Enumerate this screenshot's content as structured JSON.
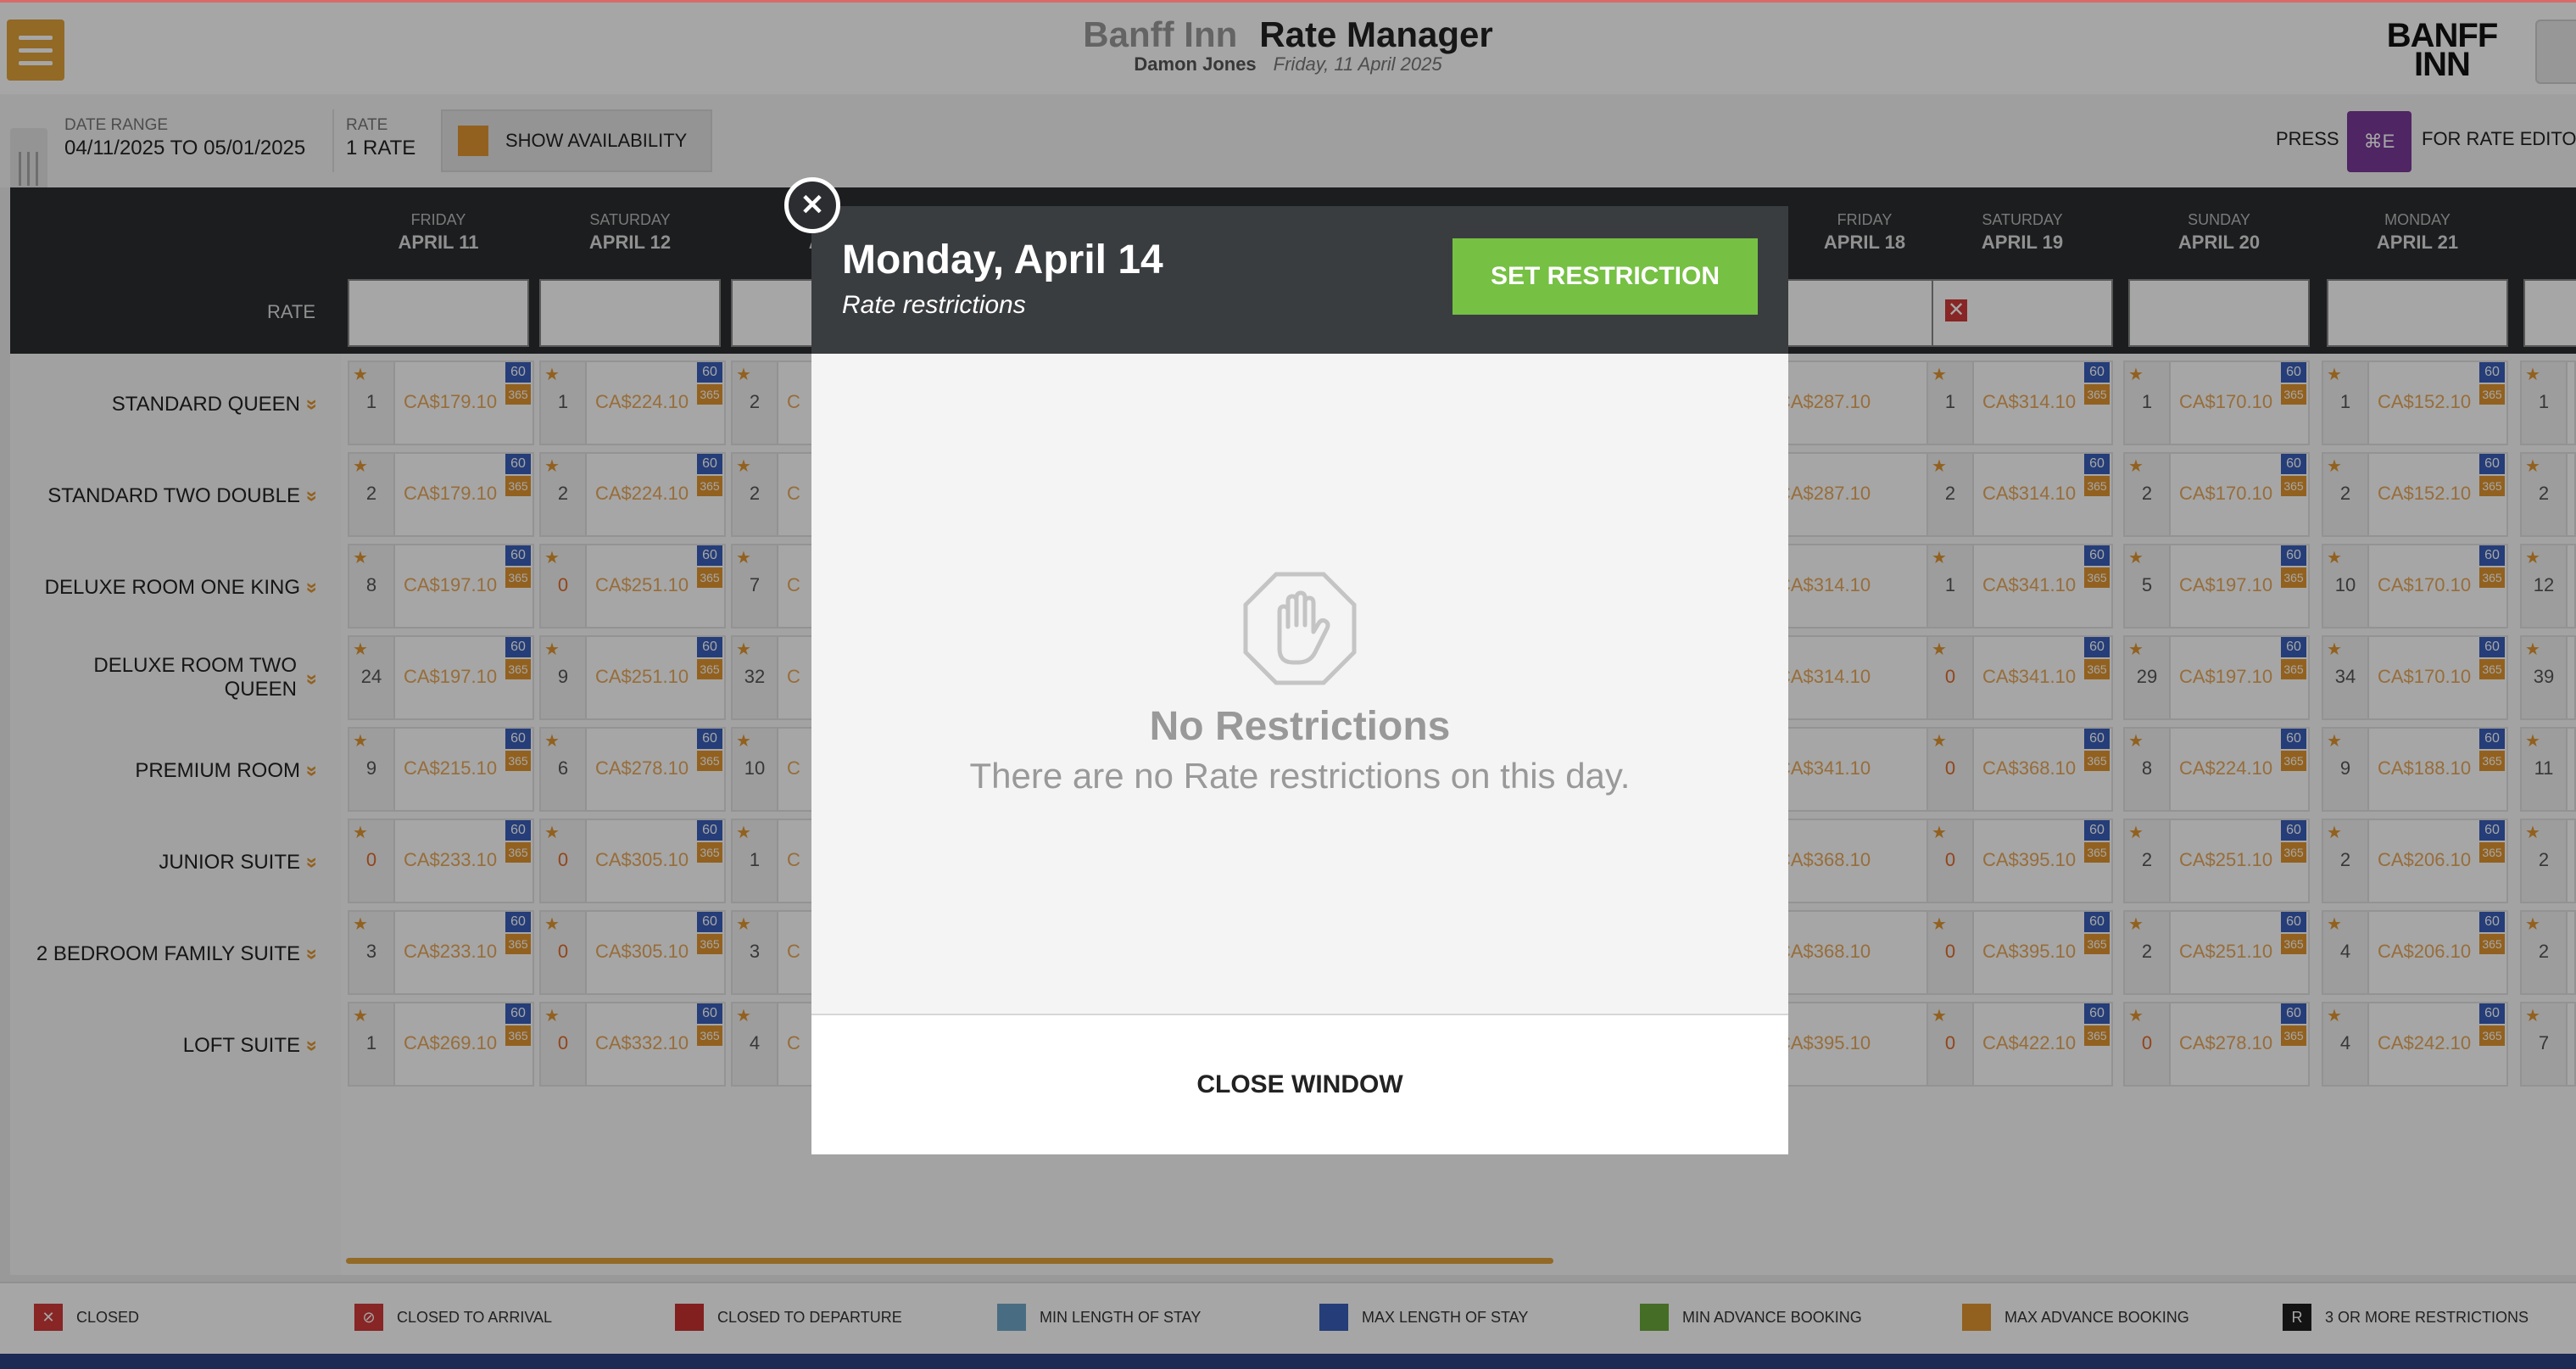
{
  "header": {
    "hotel": "Banff Inn",
    "app_title": "Rate Manager",
    "user": "Damon Jones",
    "date": "Friday, 11 April 2025",
    "logo_line1": "BANFF",
    "logo_line2": "INN"
  },
  "toolbar": {
    "date_range_label": "DATE RANGE",
    "date_range_value": "04/11/2025 TO 05/01/2025",
    "rate_label": "RATE",
    "rate_value": "1 RATE",
    "availability_button": "SHOW AVAILABILITY",
    "press": "PRESS",
    "shortcut": "⌘E",
    "for_rate_editor": "FOR RATE EDITOR"
  },
  "grid": {
    "rate_row_label": "RATE",
    "columns": [
      {
        "dow": "FRIDAY",
        "date": "APRIL 11"
      },
      {
        "dow": "SATURDAY",
        "date": "APRIL 12"
      },
      {
        "dow": "",
        "date": "AP"
      },
      {
        "dow": "FRIDAY",
        "date": "APRIL 18"
      },
      {
        "dow": "SATURDAY",
        "date": "APRIL 19"
      },
      {
        "dow": "SUNDAY",
        "date": "APRIL 20"
      },
      {
        "dow": "MONDAY",
        "date": "APRIL 21"
      }
    ],
    "closed_mark": "✕",
    "rooms": [
      {
        "name": "STANDARD QUEEN",
        "cells": [
          [
            "1",
            "CA$179.10"
          ],
          [
            "1",
            "CA$224.10"
          ],
          [
            "2",
            "C"
          ],
          [
            "",
            "CA$287.10"
          ],
          [
            "1",
            "CA$314.10"
          ],
          [
            "1",
            "CA$170.10"
          ],
          [
            "1",
            "CA$152.10"
          ],
          [
            "1",
            ""
          ]
        ]
      },
      {
        "name": "STANDARD TWO DOUBLE",
        "cells": [
          [
            "2",
            "CA$179.10"
          ],
          [
            "2",
            "CA$224.10"
          ],
          [
            "2",
            "C"
          ],
          [
            "",
            "CA$287.10"
          ],
          [
            "2",
            "CA$314.10"
          ],
          [
            "2",
            "CA$170.10"
          ],
          [
            "2",
            "CA$152.10"
          ],
          [
            "2",
            ""
          ]
        ]
      },
      {
        "name": "DELUXE ROOM ONE KING",
        "cells": [
          [
            "8",
            "CA$197.10"
          ],
          [
            "0",
            "CA$251.10"
          ],
          [
            "7",
            "C"
          ],
          [
            "",
            "CA$314.10"
          ],
          [
            "1",
            "CA$341.10"
          ],
          [
            "5",
            "CA$197.10"
          ],
          [
            "10",
            "CA$170.10"
          ],
          [
            "12",
            ""
          ]
        ]
      },
      {
        "name": "DELUXE ROOM TWO QUEEN",
        "cells": [
          [
            "24",
            "CA$197.10"
          ],
          [
            "9",
            "CA$251.10"
          ],
          [
            "32",
            "C"
          ],
          [
            "",
            "CA$314.10"
          ],
          [
            "0",
            "CA$341.10"
          ],
          [
            "29",
            "CA$197.10"
          ],
          [
            "34",
            "CA$170.10"
          ],
          [
            "39",
            ""
          ]
        ]
      },
      {
        "name": "PREMIUM ROOM",
        "cells": [
          [
            "9",
            "CA$215.10"
          ],
          [
            "6",
            "CA$278.10"
          ],
          [
            "10",
            "C"
          ],
          [
            "",
            "CA$341.10"
          ],
          [
            "0",
            "CA$368.10"
          ],
          [
            "8",
            "CA$224.10"
          ],
          [
            "9",
            "CA$188.10"
          ],
          [
            "11",
            ""
          ]
        ]
      },
      {
        "name": "JUNIOR SUITE",
        "cells": [
          [
            "0",
            "CA$233.10"
          ],
          [
            "0",
            "CA$305.10"
          ],
          [
            "1",
            "C"
          ],
          [
            "",
            "CA$368.10"
          ],
          [
            "0",
            "CA$395.10"
          ],
          [
            "2",
            "CA$251.10"
          ],
          [
            "2",
            "CA$206.10"
          ],
          [
            "2",
            ""
          ]
        ]
      },
      {
        "name": "2 BEDROOM FAMILY SUITE",
        "cells": [
          [
            "3",
            "CA$233.10"
          ],
          [
            "0",
            "CA$305.10"
          ],
          [
            "3",
            "C"
          ],
          [
            "",
            "CA$368.10"
          ],
          [
            "0",
            "CA$395.10"
          ],
          [
            "2",
            "CA$251.10"
          ],
          [
            "4",
            "CA$206.10"
          ],
          [
            "2",
            ""
          ]
        ]
      },
      {
        "name": "LOFT SUITE",
        "cells": [
          [
            "1",
            "CA$269.10"
          ],
          [
            "0",
            "CA$332.10"
          ],
          [
            "4",
            "C"
          ],
          [
            "",
            "CA$395.10"
          ],
          [
            "0",
            "CA$422.10"
          ],
          [
            "0",
            "CA$278.10"
          ],
          [
            "4",
            "CA$242.10"
          ],
          [
            "7",
            ""
          ]
        ]
      }
    ],
    "badge_top": "60",
    "badge_bottom": "365"
  },
  "legend": [
    {
      "label": "CLOSED",
      "color": "#d23a3a",
      "glyph": "✕"
    },
    {
      "label": "CLOSED TO ARRIVAL",
      "color": "#d23a3a",
      "glyph": "⊘"
    },
    {
      "label": "CLOSED TO DEPARTURE",
      "color": "#c83232",
      "glyph": ""
    },
    {
      "label": "MIN LENGTH OF STAY",
      "color": "#6fa8c8",
      "glyph": ""
    },
    {
      "label": "MAX LENGTH OF STAY",
      "color": "#3a5fb8",
      "glyph": ""
    },
    {
      "label": "MIN ADVANCE BOOKING",
      "color": "#6ba83a",
      "glyph": ""
    },
    {
      "label": "MAX ADVANCE BOOKING",
      "color": "#e09630",
      "glyph": ""
    },
    {
      "label": "3 OR MORE RESTRICTIONS",
      "color": "#1e1e1e",
      "glyph": "R"
    }
  ],
  "modal": {
    "title": "Monday, April 14",
    "subtitle": "Rate restrictions",
    "set_button": "SET RESTRICTION",
    "empty_title": "No Restrictions",
    "empty_text": "There are no Rate restrictions on this day.",
    "close_button": "CLOSE WINDOW",
    "close_icon": "✕"
  }
}
